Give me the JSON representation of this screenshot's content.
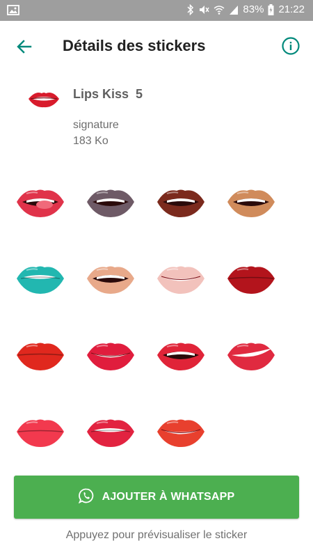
{
  "status_bar": {
    "battery": "83%",
    "time": "21:22",
    "icons": [
      "image-icon",
      "bluetooth-icon",
      "mute-icon",
      "wifi-icon",
      "signal-icon",
      "battery-icon"
    ]
  },
  "header": {
    "title": "Détails des stickers",
    "back_icon": "arrow-back-icon",
    "info_icon": "info-icon",
    "accent_color": "#00897b"
  },
  "pack": {
    "name": "Lips Kiss  5",
    "author": "signature",
    "size": "183 Ko"
  },
  "stickers": [
    {
      "style": "tongue",
      "color": "#e0334a"
    },
    {
      "style": "open",
      "color": "#6e5a66"
    },
    {
      "style": "open",
      "color": "#7b2a1d"
    },
    {
      "style": "open",
      "color": "#d08b5b"
    },
    {
      "style": "bite",
      "color": "#22b7b0"
    },
    {
      "style": "open",
      "color": "#e8a98a"
    },
    {
      "style": "smile",
      "color": "#f2c2bc"
    },
    {
      "style": "pout",
      "color": "#b3141c"
    },
    {
      "style": "closed",
      "color": "#e0281e"
    },
    {
      "style": "smile",
      "color": "#e01d3d"
    },
    {
      "style": "open",
      "color": "#e02438"
    },
    {
      "style": "smirk",
      "color": "#e02a40"
    },
    {
      "style": "pout",
      "color": "#f2394e"
    },
    {
      "style": "bite",
      "color": "#e22340"
    },
    {
      "style": "smile",
      "color": "#e8402e"
    }
  ],
  "actions": {
    "add_button": "AJOUTER À WHATSAPP",
    "add_icon": "whatsapp-icon",
    "button_color": "#4caf50",
    "hint": "Appuyez pour prévisualiser le sticker"
  }
}
